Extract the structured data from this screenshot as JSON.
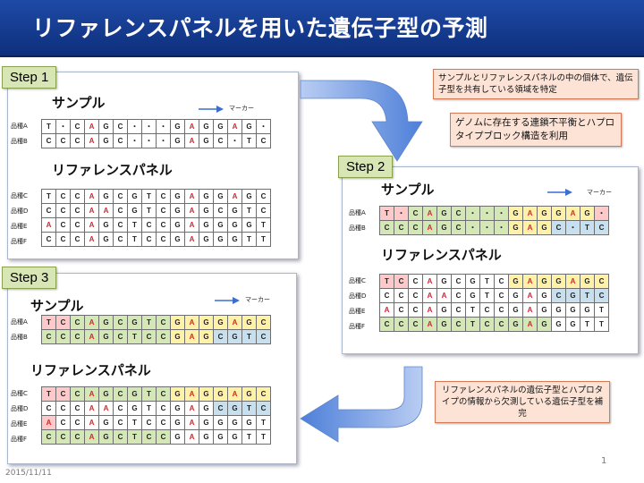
{
  "title": "リファレンスパネルを用いた遺伝子型の予測",
  "labels": {
    "sample": "サンプル",
    "reference": "リファレンスパネル",
    "marker": "マーカー"
  },
  "steps": [
    "Step 1",
    "Step 2",
    "Step 3"
  ],
  "notes": {
    "top1": "サンプルとリファレンスパネルの中の個体で、遺伝子型を共有している領域を特定",
    "top2": "ゲノムに存在する連鎖不平衡とハプロタイプブロック構造を利用",
    "bottom": "リファレンスパネルの遺伝子型とハプロタイプの情報から欠測している遺伝子型を補完"
  },
  "footer": {
    "date": "2015/11/11",
    "page": "1"
  },
  "colors": {
    "title_bar": "#1e4aa6",
    "step_label": "#d8e6b5",
    "note_box": "#fde3d6",
    "red": "#ffc9c9",
    "yellow": "#fff2a6",
    "green": "#d3e8b5",
    "blue": "#c6e0ef"
  },
  "step1": {
    "sample": [
      {
        "name": "品種A",
        "cells": [
          "T",
          "・",
          "C",
          "A",
          "G",
          "C",
          "・",
          "・",
          "・",
          "G",
          "A",
          "G",
          "G",
          "A",
          "G",
          "・"
        ]
      },
      {
        "name": "品種B",
        "cells": [
          "C",
          "C",
          "C",
          "A",
          "G",
          "C",
          "・",
          "・",
          "・",
          "G",
          "A",
          "G",
          "C",
          "・",
          "T",
          "C"
        ]
      }
    ],
    "reference": [
      {
        "name": "品種C",
        "cells": [
          "T",
          "C",
          "C",
          "A",
          "G",
          "C",
          "G",
          "T",
          "C",
          "G",
          "A",
          "G",
          "G",
          "A",
          "G",
          "C"
        ]
      },
      {
        "name": "品種D",
        "cells": [
          "C",
          "C",
          "C",
          "A",
          "A",
          "C",
          "G",
          "T",
          "C",
          "G",
          "A",
          "G",
          "C",
          "G",
          "T",
          "C"
        ]
      },
      {
        "name": "品種E",
        "cells": [
          "A",
          "C",
          "C",
          "A",
          "G",
          "C",
          "T",
          "C",
          "C",
          "G",
          "A",
          "G",
          "G",
          "G",
          "G",
          "T"
        ]
      },
      {
        "name": "品種F",
        "cells": [
          "C",
          "C",
          "C",
          "A",
          "G",
          "C",
          "T",
          "C",
          "C",
          "G",
          "A",
          "G",
          "G",
          "G",
          "T",
          "T"
        ]
      }
    ]
  },
  "step2": {
    "sample": [
      {
        "name": "品種A",
        "cells": [
          "T",
          "・",
          "C",
          "A",
          "G",
          "C",
          "・",
          "・",
          "・",
          "G",
          "A",
          "G",
          "G",
          "A",
          "G",
          "・"
        ]
      },
      {
        "name": "品種B",
        "cells": [
          "C",
          "C",
          "C",
          "A",
          "G",
          "C",
          "・",
          "・",
          "・",
          "G",
          "A",
          "G",
          "C",
          "・",
          "T",
          "C"
        ]
      }
    ],
    "reference": [
      {
        "name": "品種C",
        "cells": [
          "T",
          "C",
          "C",
          "A",
          "G",
          "C",
          "G",
          "T",
          "C",
          "G",
          "A",
          "G",
          "G",
          "A",
          "G",
          "C"
        ]
      },
      {
        "name": "品種D",
        "cells": [
          "C",
          "C",
          "C",
          "A",
          "A",
          "C",
          "G",
          "T",
          "C",
          "G",
          "A",
          "G",
          "C",
          "G",
          "T",
          "C"
        ]
      },
      {
        "name": "品種E",
        "cells": [
          "A",
          "C",
          "C",
          "A",
          "G",
          "C",
          "T",
          "C",
          "C",
          "G",
          "A",
          "G",
          "G",
          "G",
          "G",
          "T"
        ]
      },
      {
        "name": "品種F",
        "cells": [
          "C",
          "C",
          "C",
          "A",
          "G",
          "C",
          "T",
          "C",
          "C",
          "G",
          "A",
          "G",
          "G",
          "G",
          "T",
          "T"
        ]
      }
    ]
  },
  "step3": {
    "sample": [
      {
        "name": "品種A",
        "cells": [
          "T",
          "C",
          "C",
          "A",
          "G",
          "C",
          "G",
          "T",
          "C",
          "G",
          "A",
          "G",
          "G",
          "A",
          "G",
          "C"
        ]
      },
      {
        "name": "品種B",
        "cells": [
          "C",
          "C",
          "C",
          "A",
          "G",
          "C",
          "T",
          "C",
          "C",
          "G",
          "A",
          "G",
          "C",
          "G",
          "T",
          "C"
        ]
      }
    ],
    "reference": [
      {
        "name": "品種C",
        "cells": [
          "T",
          "C",
          "C",
          "A",
          "G",
          "C",
          "G",
          "T",
          "C",
          "G",
          "A",
          "G",
          "G",
          "A",
          "G",
          "C"
        ]
      },
      {
        "name": "品種D",
        "cells": [
          "C",
          "C",
          "C",
          "A",
          "A",
          "C",
          "G",
          "T",
          "C",
          "G",
          "A",
          "G",
          "C",
          "G",
          "T",
          "C"
        ]
      },
      {
        "name": "品種E",
        "cells": [
          "A",
          "C",
          "C",
          "A",
          "G",
          "C",
          "T",
          "C",
          "C",
          "G",
          "A",
          "G",
          "G",
          "G",
          "G",
          "T"
        ]
      },
      {
        "name": "品種F",
        "cells": [
          "C",
          "C",
          "C",
          "A",
          "G",
          "C",
          "T",
          "C",
          "C",
          "G",
          "A",
          "G",
          "G",
          "G",
          "T",
          "T"
        ]
      }
    ]
  }
}
